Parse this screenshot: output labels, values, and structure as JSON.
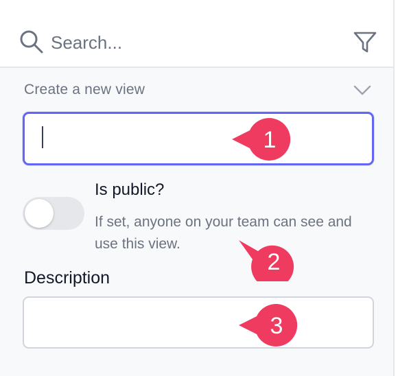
{
  "search": {
    "placeholder": "Search..."
  },
  "view_form": {
    "section_title": "Create a new view",
    "name_value": "",
    "public_label": "Is public?",
    "public_help": "If set, anyone on your team can see and use this view.",
    "public_enabled": false,
    "description_label": "Description",
    "description_value": ""
  },
  "markers": [
    "1",
    "2",
    "3"
  ],
  "colors": {
    "accent": "#6366f1",
    "marker": "#ef3b5f",
    "toggle_off": "#e5e7eb"
  }
}
